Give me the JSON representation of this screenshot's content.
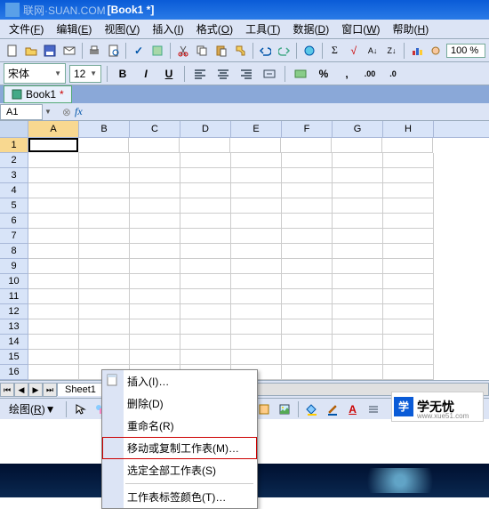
{
  "titlebar": {
    "watermark": "联网·SUAN.COM",
    "doc": "[Book1 *]"
  },
  "menus": {
    "file": "文件",
    "file_u": "F",
    "edit": "编辑",
    "edit_u": "E",
    "view": "视图",
    "view_u": "V",
    "insert": "插入",
    "insert_u": "I",
    "format": "格式",
    "format_u": "O",
    "tools": "工具",
    "tools_u": "T",
    "data": "数据",
    "data_u": "D",
    "window": "窗口",
    "window_u": "W",
    "help": "帮助",
    "help_u": "H"
  },
  "toolbar": {
    "zoom": "100 %"
  },
  "format": {
    "font": "宋体",
    "size": "12",
    "bold": "B",
    "italic": "I",
    "underline": "U"
  },
  "doc_tab": {
    "name": "Book1",
    "dirty": "*"
  },
  "cell_ref": "A1",
  "fx": "fx",
  "columns": [
    "A",
    "B",
    "C",
    "D",
    "E",
    "F",
    "G",
    "H"
  ],
  "rows": [
    "1",
    "2",
    "3",
    "4",
    "5",
    "6",
    "7",
    "8",
    "9",
    "10",
    "11",
    "12",
    "13",
    "14",
    "15",
    "16"
  ],
  "sheet_tab": "Sheet1",
  "draw_label": "绘图",
  "draw_label_u": "R",
  "context_menu": {
    "insert": "插入(I)…",
    "delete": "删除(D)",
    "rename": "重命名(R)",
    "move_copy": "移动或复制工作表(M)…",
    "select_all": "选定全部工作表(S)",
    "tab_color": "工作表标签颜色(T)…"
  },
  "logo": {
    "mark": "学",
    "text": "学无忧",
    "url": "www.xue51.com"
  }
}
